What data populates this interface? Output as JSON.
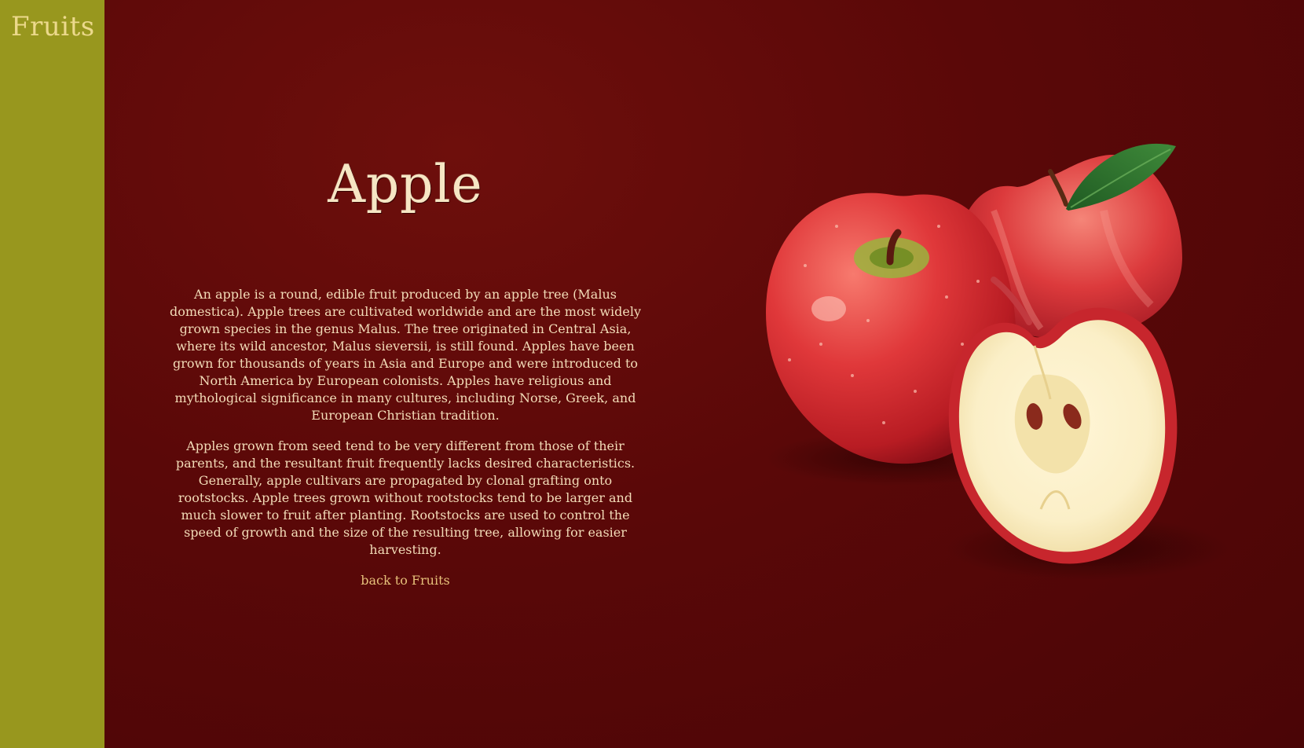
{
  "sidebar": {
    "brand_label": "Fruits"
  },
  "article": {
    "title": "Apple",
    "paragraphs": [
      "An apple is a round, edible fruit produced by an apple tree (Malus domestica). Apple trees are cultivated worldwide and are the most widely grown species in the genus Malus. The tree originated in Central Asia, where its wild ancestor, Malus sieversii, is still found. Apples have been grown for thousands of years in Asia and Europe and were introduced to North America by European colonists. Apples have religious and mythological significance in many cultures, including Norse, Greek, and European Christian tradition.",
      "Apples grown from seed tend to be very different from those of their parents, and the resultant fruit frequently lacks desired characteristics. Generally, apple cultivars are propagated by clonal grafting onto rootstocks. Apple trees grown without rootstocks tend to be larger and much slower to fruit after planting. Rootstocks are used to control the speed of growth and the size of the resulting tree, allowing for easier harvesting."
    ],
    "back_link_label": "back to Fruits"
  },
  "colors": {
    "sidebar_bg": "#98971e",
    "page_bg": "#5a0808",
    "brand_text": "#ecd98c",
    "body_text": "#f3dcb8",
    "link_text": "#e6c07a"
  },
  "illustration": {
    "icon": "apple-illustration"
  }
}
